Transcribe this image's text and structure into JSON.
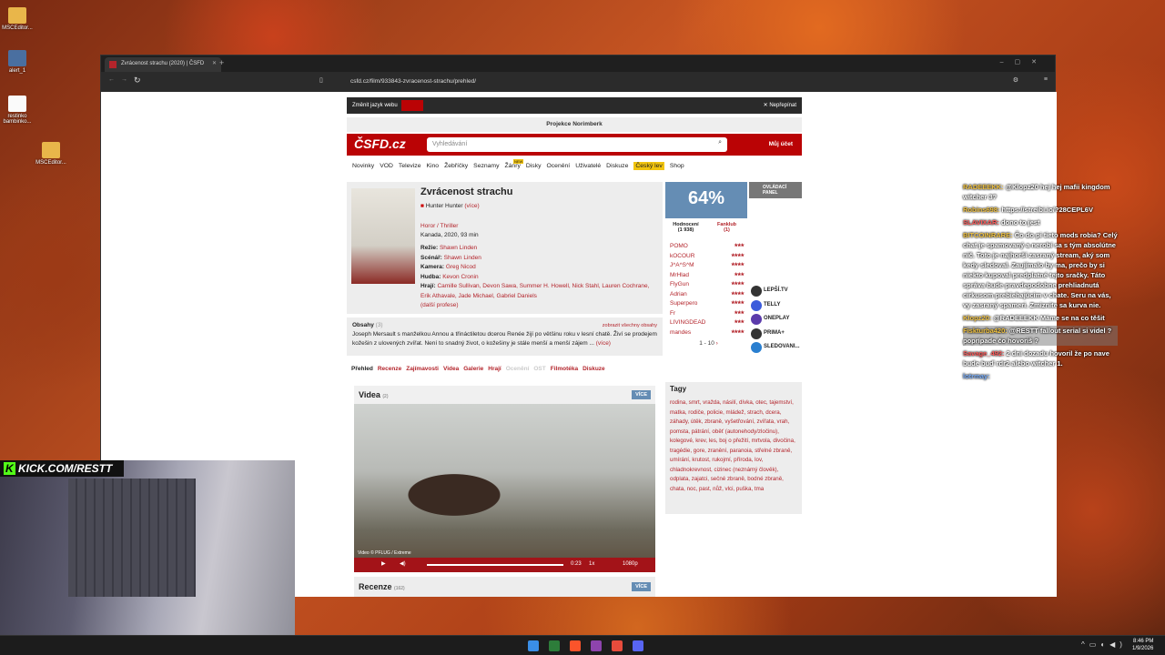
{
  "desktop": {
    "icons": [
      {
        "label": "MSCEditor..."
      },
      {
        "label": "alert_1"
      },
      {
        "label": "restinko bambinko..."
      },
      {
        "label": "MSCEditor..."
      }
    ]
  },
  "browser": {
    "tab_title": "Zvrácenost strachu (2020) | ČSFD",
    "url": "csfd.cz/film/933843-zvracenost-strachu/prehled/"
  },
  "csfd": {
    "lang_label": "Změnit jazyk webu",
    "close_label": "Nepřepínat",
    "promo": "Projekce Norimberk",
    "search_placeholder": "Vyhledávání",
    "account": "Můj účet",
    "nav": [
      "Novinky",
      "VOD",
      "Televize",
      "Kino",
      "Žebříčky",
      "Seznamy",
      "Žánry",
      "Disky",
      "Ocenění",
      "Uživatelé",
      "Diskuze",
      "Český lev",
      "Shop"
    ],
    "new_badge": "NEW",
    "film": {
      "title": "Zvrácenost strachu",
      "orig": "Hunter Hunter",
      "orig_more": "(více)",
      "genre": "Horor / Thriller",
      "meta": "Kanada, 2020, 93 min",
      "credits": [
        {
          "k": "Režie:",
          "v": "Shawn Linden"
        },
        {
          "k": "Scénář:",
          "v": "Shawn Linden"
        },
        {
          "k": "Kamera:",
          "v": "Greg Nicod"
        },
        {
          "k": "Hudba:",
          "v": "Kevon Cronin"
        }
      ],
      "actors_k": "Hrají:",
      "actors": "Camille Sullivan, Devon Sawa, Summer H. Howell, Nick Stahl, Lauren Cochrane, Erik Athavale, Jade Michael, Gabriel Daniels",
      "more": "(další profese)"
    },
    "synopsis": {
      "title": "Obsahy",
      "count": "(3)",
      "all": "zobrazit všechny obsahy",
      "text": "Joseph Mersault s manželkou Annou a třináctiletou dcerou Renée žijí po většinu roku v lesní chatě. Živí se prodejem kožešin z ulovených zvířat. Není to snadný život, o kožešiny je stále menší a menší zájem ...",
      "more": "(více)"
    },
    "tabs": [
      "Přehled",
      "Recenze",
      "Zajímavosti",
      "Videa",
      "Galerie",
      "Hrají",
      "Ocenění",
      "OST",
      "Filmotéka",
      "Diskuze"
    ],
    "videos": {
      "title": "Videa",
      "count": "(2)",
      "more": "VÍCE",
      "caption": "Video © PFLUG / Extreme",
      "time": "0:23",
      "speed": "1x",
      "quality": "1080p"
    },
    "reviews": {
      "title": "Recenze",
      "count": "(162)",
      "more": "VÍCE"
    },
    "rating": {
      "value": "64%",
      "tab1": "Hodnocení",
      "tab1_count": "(1 938)",
      "tab2": "Fanklub",
      "tab2_count": "(1)",
      "users": [
        {
          "n": "POMO",
          "s": "★★★"
        },
        {
          "n": "kOCOUR",
          "s": "★★★★"
        },
        {
          "n": "J^A^S^M",
          "s": "★★★★"
        },
        {
          "n": "MrHlad",
          "s": "★★★"
        },
        {
          "n": "FlyGun",
          "s": "★★★★"
        },
        {
          "n": "Adrian",
          "s": "★★★★"
        },
        {
          "n": "Superpero",
          "s": "★★★★"
        },
        {
          "n": "Fr",
          "s": "★★★"
        },
        {
          "n": "LIVINGDEAD",
          "s": "★★★"
        },
        {
          "n": "mandes",
          "s": "★★★★"
        }
      ],
      "pager": "1 - 10"
    },
    "panel": "OVLÁDACÍ PANEL",
    "vod": [
      "LEPŠÍ.TV",
      "TELLY",
      "ONEPLAY",
      "PRIMA+",
      "SLEDOVANI..."
    ],
    "tags_title": "Tagy",
    "tags": "rodina, smrt, vražda, násilí, dívka, otec, tajemství, matka, rodiče, policie, mládež, strach, dcera, záhady, útěk, zbraně, vyšetřování, zvířata, vrah, pomsta, pátrání, oběť (autonehody/zločinu), kolegové, krev, les, boj o přežití, mrtvola, divočina, tragédie, gore, zranění, paranoia, střelné zbraně, umírání, krutost, rukojmí, příroda, lov, chladnokrevnost, cizinec (neznámý člověk), odplata, zajatci, sečné zbraně, bodné zbraně, chata, noc, past, nůž, vlci, puška, tma"
  },
  "overlay": {
    "kick": "KICK.COM/RESTT"
  },
  "chat": [
    {
      "n": "RADEEEKK:",
      "t": "@Klopz20 hej hej mafii kingdom witcher 3?"
    },
    {
      "n": "Robins698:",
      "t": "https://streibi.io/?28CEPL6V"
    },
    {
      "n": "SLAVIXAR:",
      "t": "dono to jest"
    },
    {
      "n": "BITCOINRARE:",
      "t": "Čo do pi tieto mods robia? Celý chat je spamovaný a nerobí sa s tým absolútne nič. Toto je najhorší zasraný stream, aký som kedy sledoval. Zaujímalo by ma, prečo by si niekto kupoval predplatné tejto sračky. Táto správa bude pravdepodobne prehliadnutá cirkusom prebiehajúcim v chate. Seru na vás, vy zasraný spameri. Zmiznite sa kurva nie."
    },
    {
      "n": "Klopz20:",
      "t": "@RADEEEKK Máme se na co těšit"
    },
    {
      "n": "Fiskturba420:",
      "t": "@RESTT fallout serial si videl ? poprípade čo hovoriš ?"
    },
    {
      "n": "Savage_492:",
      "t": "2 dni dozadu hovoril že po nave bude buď rdr2 alebo witcher 1."
    },
    {
      "n": "lotrmay:",
      "t": ""
    }
  ],
  "taskbar": {
    "time": "8:46 PM",
    "date": "1/9/2026"
  }
}
